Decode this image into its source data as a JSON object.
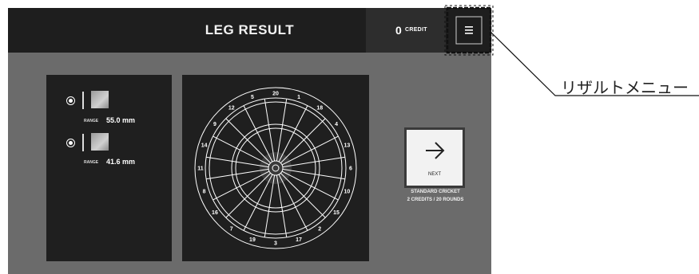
{
  "header": {
    "title": "LEG RESULT",
    "credit_count": "0",
    "credit_label": "CREDIT"
  },
  "menu": {
    "icon": "hamburger-menu-icon"
  },
  "throws": [
    {
      "range_label": "RANGE",
      "range_value": "55.0 mm"
    },
    {
      "range_label": "RANGE",
      "range_value": "41.6 mm"
    }
  ],
  "dartboard": {
    "numbers": [
      "20",
      "1",
      "18",
      "4",
      "13",
      "6",
      "10",
      "15",
      "2",
      "17",
      "3",
      "19",
      "7",
      "16",
      "8",
      "11",
      "14",
      "9",
      "12",
      "5"
    ]
  },
  "next": {
    "label": "NEXT",
    "icon": "arrow-right-icon"
  },
  "game": {
    "name": "STANDARD CRICKET",
    "details": "2 CREDITS / 20 ROUNDS"
  },
  "annotation": {
    "label": "リザルトメニュー"
  }
}
